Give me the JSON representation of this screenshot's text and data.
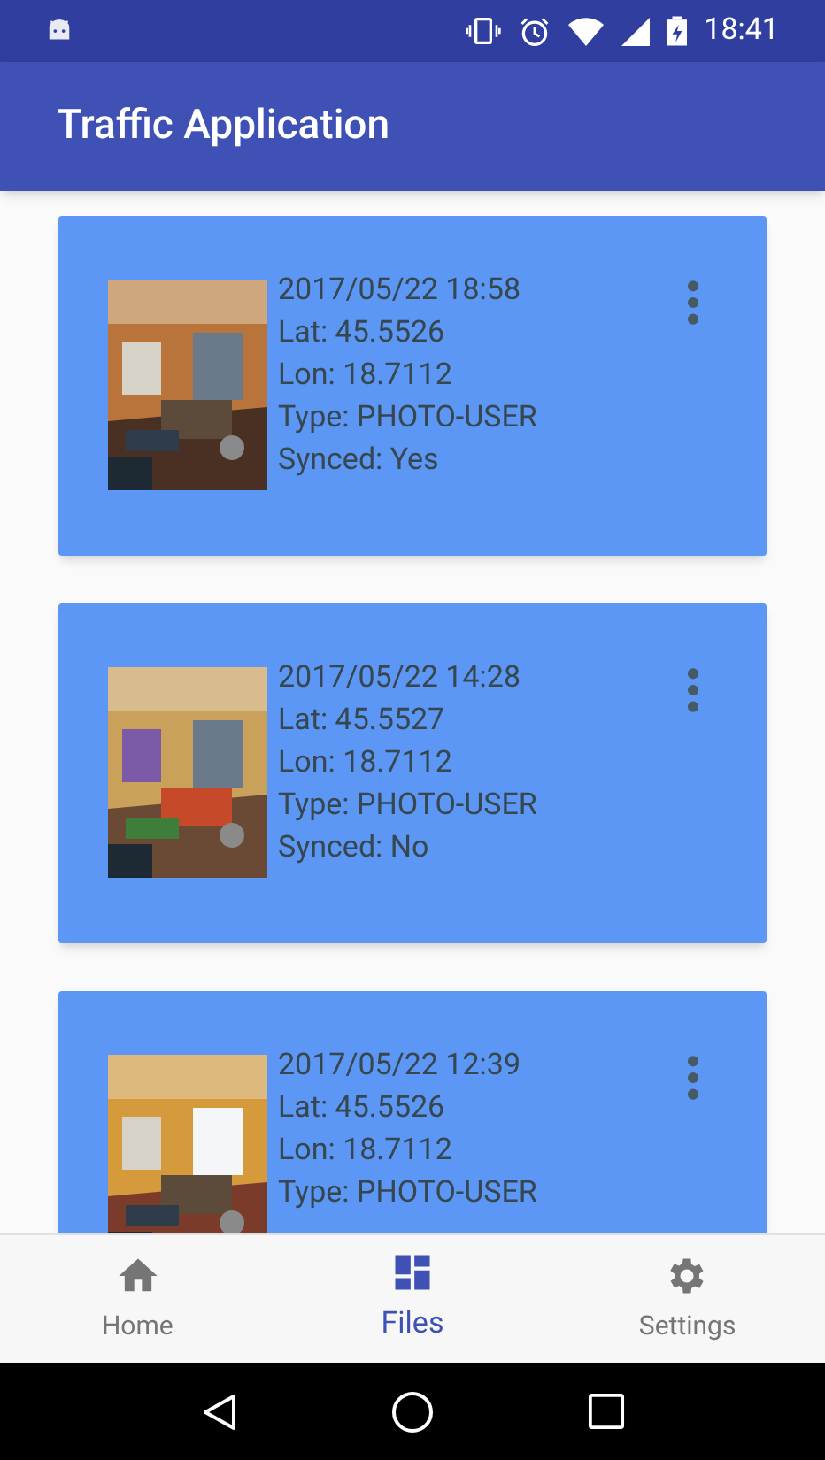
{
  "status_bar": {
    "time": "18:41"
  },
  "app_bar": {
    "title": "Traffic Application"
  },
  "files": [
    {
      "datetime": "2017/05/22 18:58",
      "lat": "Lat: 45.5526",
      "lon": "Lon: 18.7112",
      "type": "Type: PHOTO-USER",
      "synced": "Synced: Yes"
    },
    {
      "datetime": "2017/05/22 14:28",
      "lat": "Lat: 45.5527",
      "lon": "Lon: 18.7112",
      "type": "Type: PHOTO-USER",
      "synced": "Synced: No"
    },
    {
      "datetime": "2017/05/22 12:39",
      "lat": "Lat: 45.5526",
      "lon": "Lon: 18.7112",
      "type": "Type: PHOTO-USER"
    }
  ],
  "bottom_nav": [
    {
      "label": "Home",
      "kind": "home",
      "selected": false
    },
    {
      "label": "Files",
      "kind": "files",
      "selected": true
    },
    {
      "label": "Settings",
      "kind": "settings",
      "selected": false
    }
  ]
}
